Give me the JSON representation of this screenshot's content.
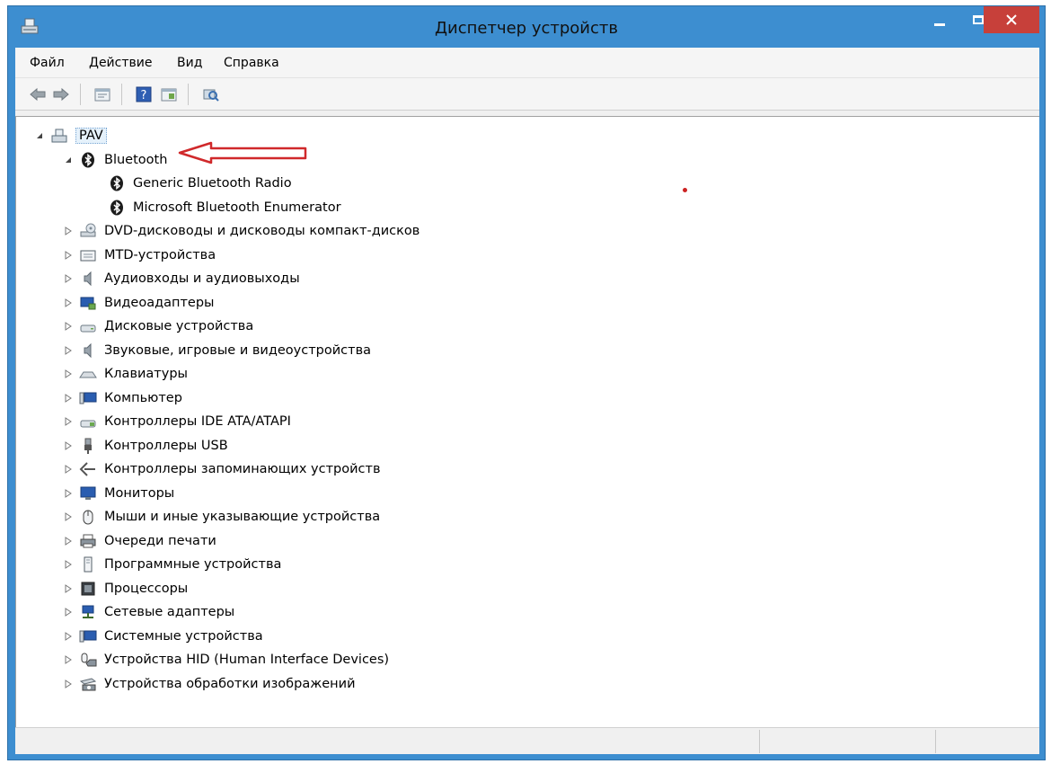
{
  "window": {
    "title": "Диспетчер устройств",
    "accent": "#3d8ed0",
    "close_color": "#c7403a"
  },
  "menu": {
    "items": [
      "Файл",
      "Действие",
      "Вид",
      "Справка"
    ]
  },
  "toolbar": {
    "buttons": [
      "back-icon",
      "forward-icon",
      "properties-icon",
      "help-icon",
      "view-icon",
      "scan-icon"
    ]
  },
  "tree": {
    "root": "PAV",
    "bluetooth": {
      "label": "Bluetooth",
      "children": [
        "Generic Bluetooth Radio",
        "Microsoft Bluetooth Enumerator"
      ]
    },
    "categories": [
      "DVD-дисководы и дисководы компакт-дисков",
      "MTD-устройства",
      "Аудиовходы и аудиовыходы",
      "Видеоадаптеры",
      "Дисковые устройства",
      "Звуковые, игровые и видеоустройства",
      "Клавиатуры",
      "Компьютер",
      "Контроллеры IDE ATA/ATAPI",
      "Контроллеры USB",
      "Контроллеры запоминающих устройств",
      "Мониторы",
      "Мыши и иные указывающие устройства",
      "Очереди печати",
      "Программные устройства",
      "Процессоры",
      "Сетевые адаптеры",
      "Системные устройства",
      "Устройства HID (Human Interface Devices)",
      "Устройства обработки изображений"
    ]
  },
  "annotation": {
    "arrow_color": "#d0292b"
  }
}
